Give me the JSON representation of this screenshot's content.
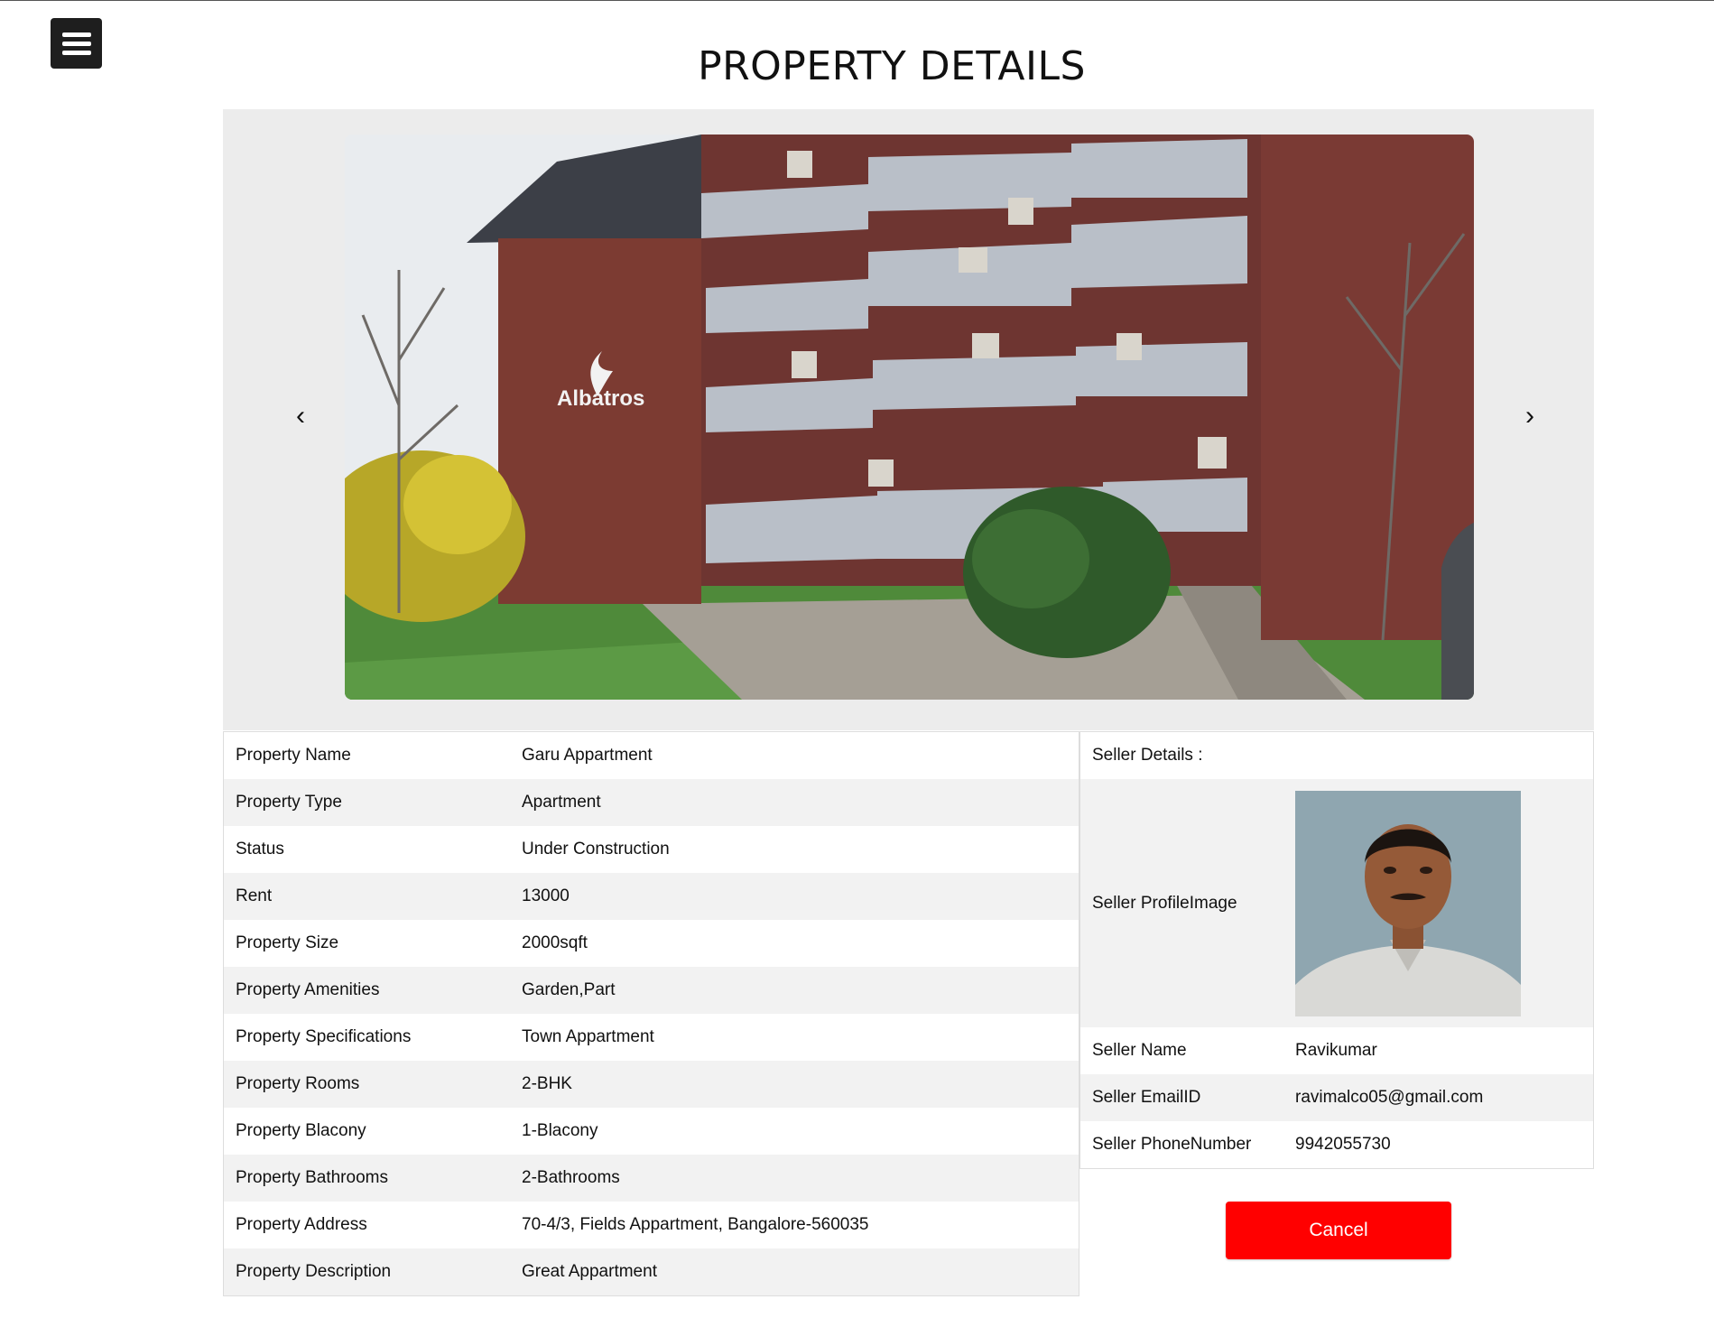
{
  "header": {
    "title": "PROPERTY DETAILS",
    "menu_icon": "hamburger-menu-icon"
  },
  "carousel": {
    "prev_label": "‹",
    "next_label": "›",
    "image_description": "Brick apartment building",
    "image_sign_text": "Albatros"
  },
  "details": [
    {
      "label": "Property Name",
      "value": "Garu Appartment"
    },
    {
      "label": "Property Type",
      "value": "Apartment"
    },
    {
      "label": "Status",
      "value": "Under Construction"
    },
    {
      "label": "Rent",
      "value": "13000"
    },
    {
      "label": "Property Size",
      "value": "2000sqft"
    },
    {
      "label": "Property Amenities",
      "value": "Garden,Part"
    },
    {
      "label": "Property Specifications",
      "value": "Town Appartment"
    },
    {
      "label": "Property Rooms",
      "value": "2-BHK"
    },
    {
      "label": "Property Blacony",
      "value": "1-Blacony"
    },
    {
      "label": "Property Bathrooms",
      "value": "2-Bathrooms"
    },
    {
      "label": "Property Address",
      "value": "70-4/3, Fields Appartment, Bangalore-560035"
    },
    {
      "label": "Property Description",
      "value": "Great Appartment"
    }
  ],
  "seller": {
    "heading": "Seller Details :",
    "profile_image_label": "Seller ProfileImage",
    "name_label": "Seller Name",
    "name": "Ravikumar",
    "email_label": "Seller EmailID",
    "email": "ravimalco05@gmail.com",
    "phone_label": "Seller PhoneNumber",
    "phone": "9942055730"
  },
  "actions": {
    "cancel_label": "Cancel"
  },
  "colors": {
    "cancel_bg": "#ff0000",
    "carousel_bg": "#ececec",
    "row_alt": "#f2f2f2"
  }
}
